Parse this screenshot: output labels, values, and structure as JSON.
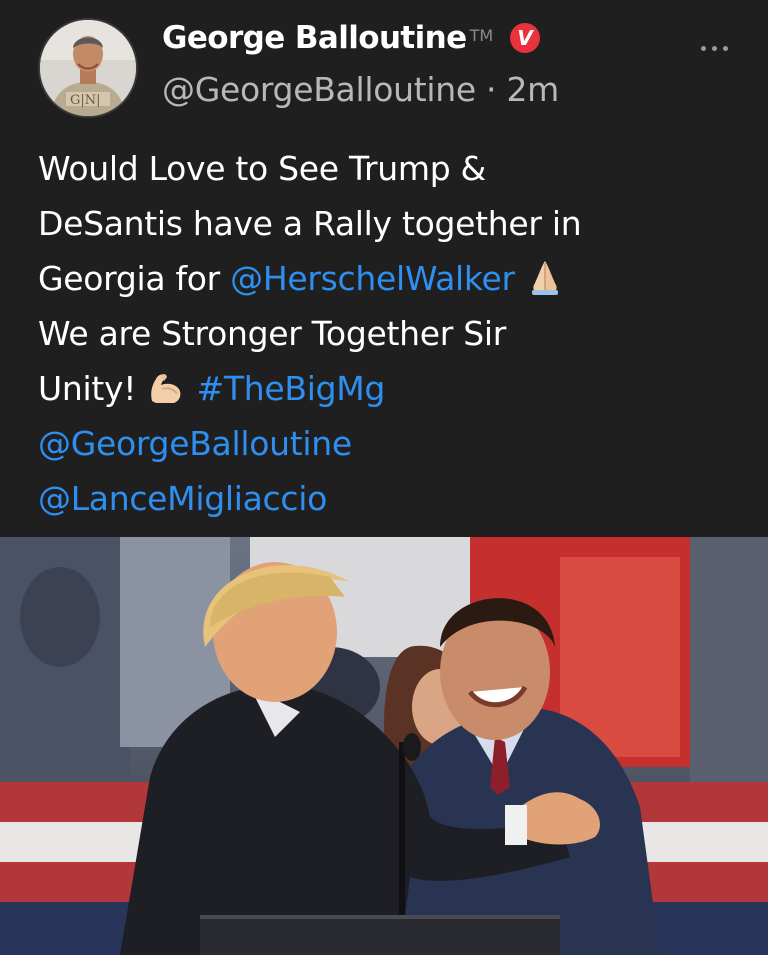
{
  "post": {
    "author": {
      "display_name": "George Balloutine",
      "trademark": "TM",
      "handle": "@GeorgeBalloutine",
      "separator": "·",
      "timestamp": "2m",
      "verified_badge_letter": "V",
      "avatar_icon": "profile-photo"
    },
    "more_icon": "ellipsis-icon",
    "text": {
      "line1": "Would Love to See Trump &",
      "line2": "DeSantis have a Rally together in",
      "line3_text": "Georgia for ",
      "line3_mention": "@HerschelWalker",
      "line4": "We are Stronger Together Sir",
      "line5_text": "Unity! ",
      "line5_hashtag": "#TheBigMg",
      "line6_mention": "@GeorgeBalloutine",
      "line7_mention": "@LanceMigliaccio"
    },
    "emojis": [
      "folded-hands-emoji",
      "flexed-biceps-emoji"
    ],
    "media_icon": "rally-photo",
    "colors": {
      "background": "#1f1f1f",
      "link": "#2f8ff0",
      "badge": "#e8323c",
      "secondary_text": "#b8b8b8"
    }
  }
}
